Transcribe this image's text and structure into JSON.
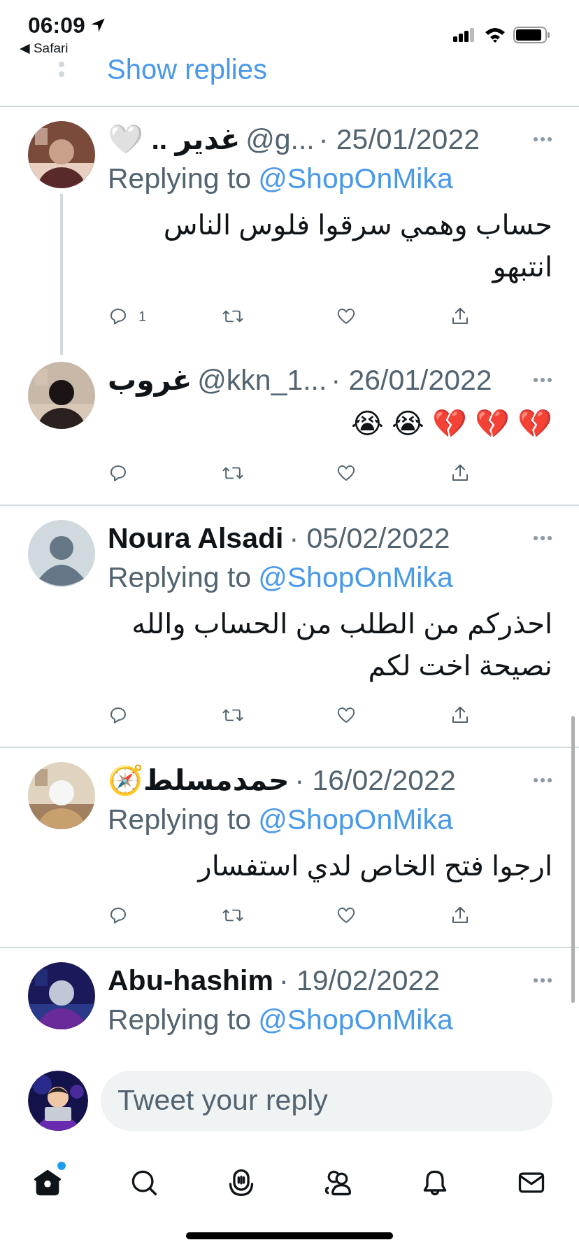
{
  "status_bar": {
    "time": "06:09",
    "back_label": "◀ Safari"
  },
  "show_replies": "Show replies",
  "tweets": [
    {
      "name": "غدير .. 🤍",
      "handle": "@g...",
      "date": "· 25/01/2022",
      "replying_to": {
        "prefix": "Replying to",
        "handle": "@ShopOnMika"
      },
      "text": "حساب وهمي سرقوا فلوس الناس\nانتبهو",
      "actions_visible": true,
      "reply_count": "1",
      "thread_continues": true
    },
    {
      "name": "غروب",
      "handle": "@kkn_1...",
      "date": "· 26/01/2022",
      "text": "💔 💔 💔 😭 😭",
      "actions_visible": true,
      "thread_continues": false
    },
    {
      "name": "Noura Alsadi",
      "date": "· 05/02/2022",
      "avatar": {
        "kind": "default"
      },
      "replying_to": {
        "prefix": "Replying to",
        "handle": "@ShopOnMika"
      },
      "text": "احذركم من الطلب من الحساب والله\nنصيحة اخت لكم",
      "actions_visible": true,
      "thread_continues": false
    },
    {
      "name": "حمدمسلط🧭",
      "date": "· 16/02/2022",
      "replying_to": {
        "prefix": "Replying to",
        "handle": "@ShopOnMika"
      },
      "text": "ارجوا فتح الخاص لدي استفسار",
      "actions_visible": true,
      "thread_continues": false
    },
    {
      "name": "Abu-hashim",
      "date": "· 19/02/2022",
      "replying_to": {
        "prefix": "Replying to",
        "handle": "@ShopOnMika"
      },
      "actions_visible": false,
      "thread_continues": false
    }
  ],
  "compose": {
    "placeholder": "Tweet your reply"
  },
  "tab_bar": [
    {
      "kind": "home",
      "selected": true,
      "badge": true
    },
    {
      "kind": "search",
      "selected": false,
      "badge": false
    },
    {
      "kind": "spaces",
      "selected": false,
      "badge": false
    },
    {
      "kind": "communities",
      "selected": false,
      "badge": false
    },
    {
      "kind": "notifications",
      "selected": false,
      "badge": false
    },
    {
      "kind": "messages",
      "selected": false,
      "badge": false
    }
  ]
}
